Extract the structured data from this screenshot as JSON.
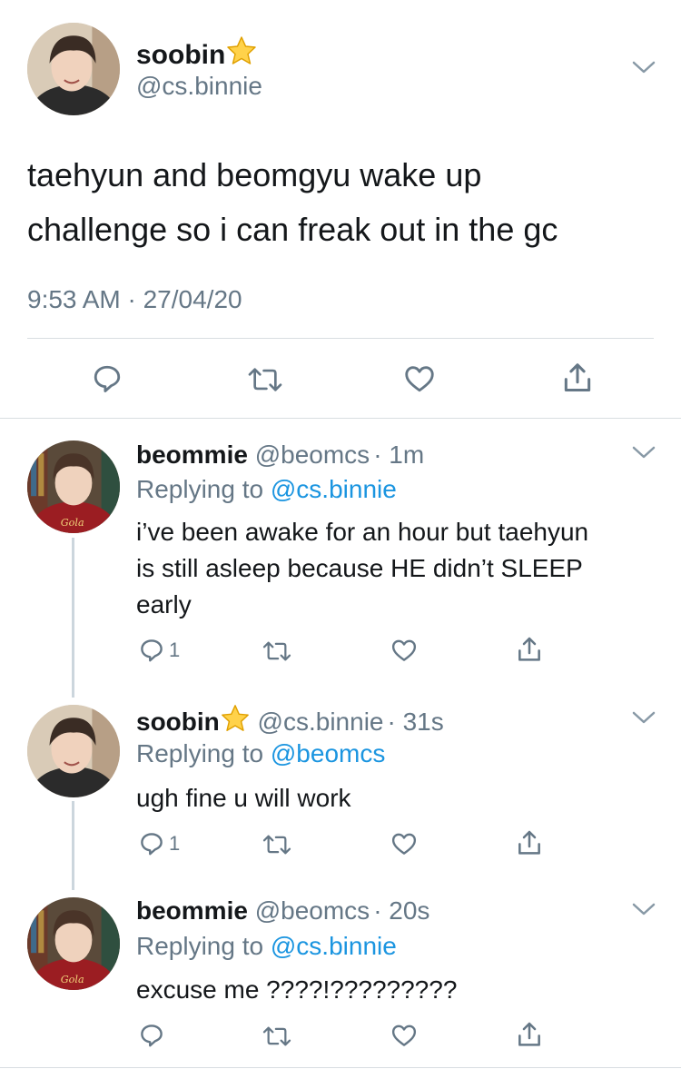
{
  "main_tweet": {
    "display_name": "soobin",
    "handle": "@cs.binnie",
    "text_line1": "taehyun and beomgyu wake up",
    "text_line2": "challenge so i can freak out in the gc",
    "timestamp": "9:53 AM · 27/04/20"
  },
  "replies": [
    {
      "display_name": "beommie",
      "handle": "@beomcs",
      "time": "· 1m",
      "replying_prefix": "Replying to",
      "replying_to": "@cs.binnie",
      "text_lines": [
        "i’ve been awake for an hour but taehyun",
        "is still asleep because HE didn’t SLEEP",
        "early"
      ],
      "reply_count": "1"
    },
    {
      "display_name": "soobin",
      "handle": "@cs.binnie",
      "time": "· 31s",
      "replying_prefix": "Replying to",
      "replying_to": "@beomcs",
      "text_lines": [
        "ugh fine u will work"
      ],
      "reply_count": "1"
    },
    {
      "display_name": "beommie",
      "handle": "@beomcs",
      "time": "· 20s",
      "replying_prefix": "Replying to",
      "replying_to": "@cs.binnie",
      "text_lines": [
        "excuse me ????!?????????"
      ],
      "reply_count": ""
    }
  ],
  "avatar_badge_text": "Gola",
  "colors": {
    "text": "#14171a",
    "muted": "#657786",
    "link": "#1b95e0",
    "divider": "#d8dde1",
    "star": "#ffd24a"
  },
  "icons": [
    "reply-icon",
    "retweet-icon",
    "like-icon",
    "share-icon",
    "chevron-down-icon",
    "star-emoji-icon"
  ]
}
